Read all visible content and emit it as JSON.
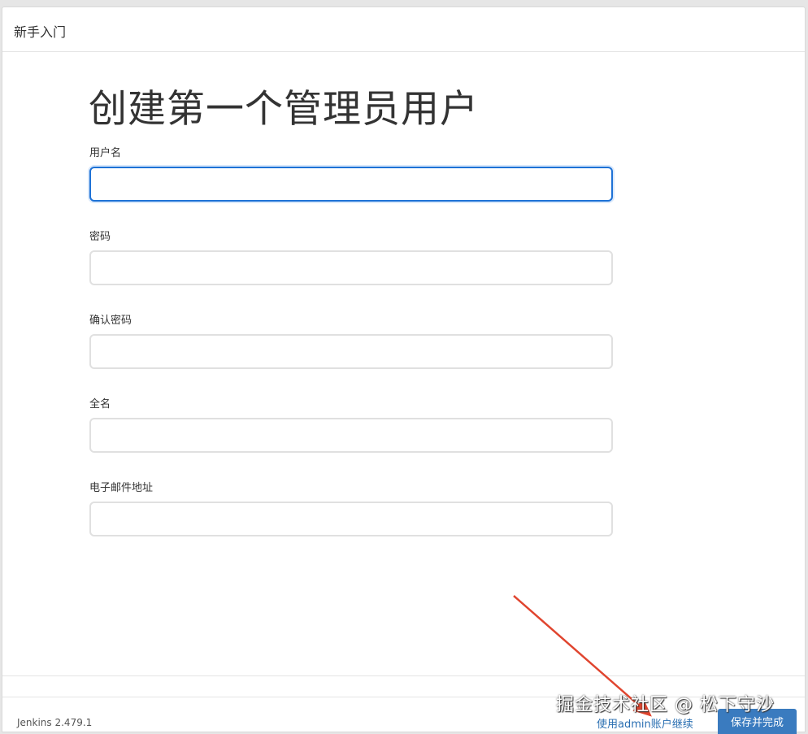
{
  "header": {
    "title": "新手入门"
  },
  "page": {
    "title": "创建第一个管理员用户"
  },
  "form": {
    "fields": [
      {
        "label": "用户名",
        "value": ""
      },
      {
        "label": "密码",
        "value": ""
      },
      {
        "label": "确认密码",
        "value": ""
      },
      {
        "label": "全名",
        "value": ""
      },
      {
        "label": "电子邮件地址",
        "value": ""
      }
    ]
  },
  "footer": {
    "version": "Jenkins 2.479.1",
    "skip_label": "使用admin账户继续",
    "save_label": "保存并完成"
  },
  "watermark": "掘金技术社区 @ 松下守沙",
  "colors": {
    "accent": "#3a7bbf",
    "focus": "#1e72d6",
    "link": "#2a6fb2",
    "annotation_arrow": "#e0452f"
  }
}
